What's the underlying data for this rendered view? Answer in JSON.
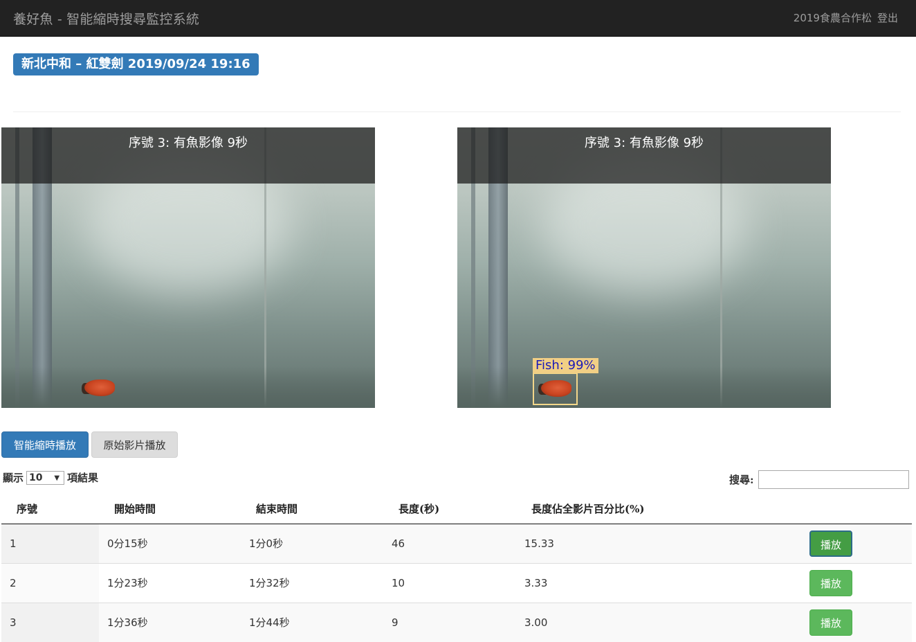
{
  "navbar": {
    "brand": "養好魚 - 智能縮時搜尋監控系統",
    "user": "2019食農合作松",
    "logout": "登出"
  },
  "page_title": "新北中和 – 紅雙劍 2019/09/24 19:16",
  "videos": {
    "left": {
      "caption": "序號 3: 有魚影像 9秒"
    },
    "right": {
      "caption": "序號 3: 有魚影像 9秒",
      "detection_label": "Fish: 99%"
    }
  },
  "buttons": {
    "smart_play": "智能縮時播放",
    "original_play": "原始影片播放"
  },
  "table_controls": {
    "show_prefix": "顯示",
    "page_length": "10",
    "show_suffix": "項結果",
    "search_label": "搜尋:"
  },
  "table": {
    "headers": [
      "序號",
      "開始時間",
      "結束時間",
      "長度(秒)",
      "長度佔全影片百分比(%)"
    ],
    "play_label": "播放",
    "rows": [
      [
        "1",
        "0分15秒",
        "1分0秒",
        "46",
        "15.33"
      ],
      [
        "2",
        "1分23秒",
        "1分32秒",
        "10",
        "3.33"
      ],
      [
        "3",
        "1分36秒",
        "1分44秒",
        "9",
        "3.00"
      ]
    ]
  }
}
